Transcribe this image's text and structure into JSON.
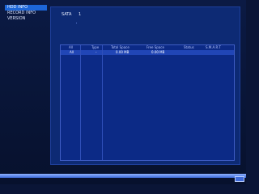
{
  "sidebar": {
    "items": [
      {
        "label": "HDD INFO"
      },
      {
        "label": "RECORD INFO"
      },
      {
        "label": "VERSION"
      }
    ]
  },
  "header": {
    "sata_label": "SATA",
    "sata_value": "1"
  },
  "table": {
    "columns": [
      "All",
      "Type",
      "Total Space",
      "Free Space",
      "Status",
      "S.M.A.R.T"
    ],
    "rows": [
      {
        "all": "All",
        "type": "-",
        "total": "0.00 MB",
        "free": "0.00 MB",
        "status": "",
        "smart": ""
      }
    ]
  }
}
